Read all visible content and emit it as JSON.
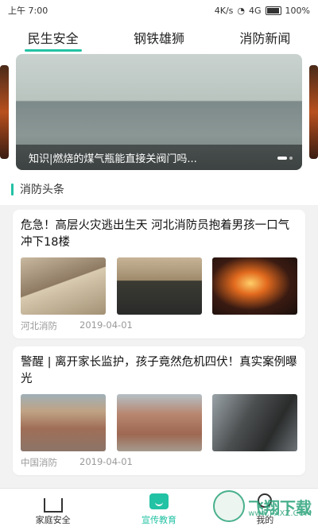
{
  "status": {
    "time": "上午 7:00",
    "right": "4K/s",
    "net": "4G",
    "battery": "100%"
  },
  "tabs": [
    {
      "label": "民生安全",
      "active": true
    },
    {
      "label": "钢铁雄狮",
      "active": false
    },
    {
      "label": "消防新闻",
      "active": false
    }
  ],
  "banner": {
    "caption": "知识|燃烧的煤气瓶能直接关阀门吗..."
  },
  "section": {
    "title": "消防头条"
  },
  "news": [
    {
      "title": "危急！高层火灾逃出生天 河北消防员抱着男孩一口气冲下18楼",
      "source": "河北消防",
      "date": "2019-04-01"
    },
    {
      "title": "警醒 | 离开家长监护，孩子竟然危机四伏！真实案例曝光",
      "source": "中国消防",
      "date": "2019-04-01"
    }
  ],
  "bottom_nav": [
    {
      "label": "家庭安全",
      "icon": "home-icon",
      "active": false
    },
    {
      "label": "宣传教育",
      "icon": "tv-icon",
      "active": true
    },
    {
      "label": "我的",
      "icon": "profile-icon",
      "active": false
    }
  ],
  "watermark": {
    "text": "飞翔下载",
    "url": "www.FXXZ.COM"
  },
  "colors": {
    "accent": "#22c2a4"
  }
}
